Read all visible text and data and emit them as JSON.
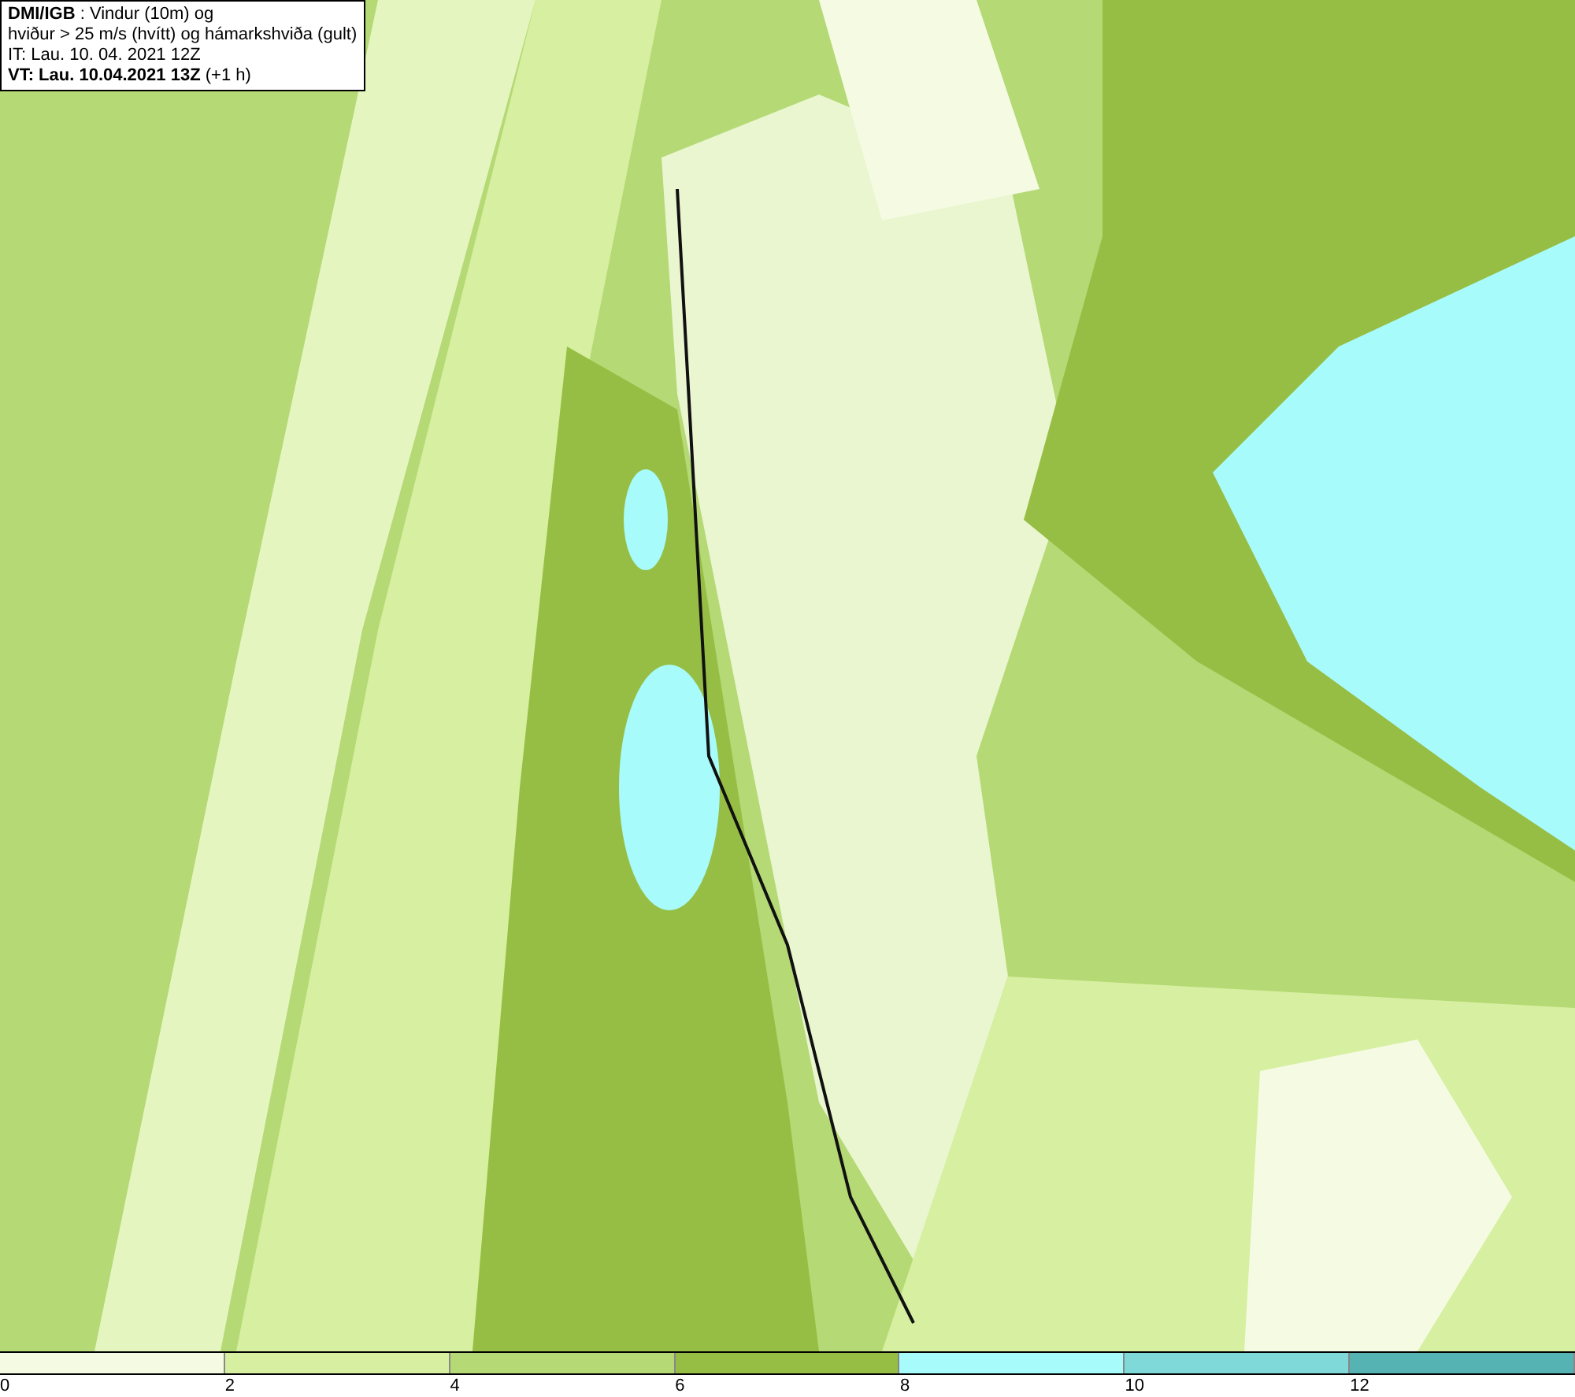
{
  "info_box": {
    "lines": [
      "**DMI/IGB** : Vindur (10m) og",
      "hviður > 25 m/s (hvítt) og hámarkshviða (gult)",
      "IT: Lau. 10. 04. 2021 12Z",
      "**VT: Lau. 10.04.2021 13Z** (+1 h)"
    ]
  },
  "color_scale": [
    {
      "label": "0",
      "color": "#f4fbe2"
    },
    {
      "label": "2",
      "color": "#d7efa0"
    },
    {
      "label": "4",
      "color": "#b5d975"
    },
    {
      "label": "6",
      "color": "#97be44"
    },
    {
      "label": "8",
      "color": "#a8fbfb"
    },
    {
      "label": "10",
      "color": "#7fd9d9"
    },
    {
      "label": "12",
      "color": "#55b3b3"
    }
  ]
}
